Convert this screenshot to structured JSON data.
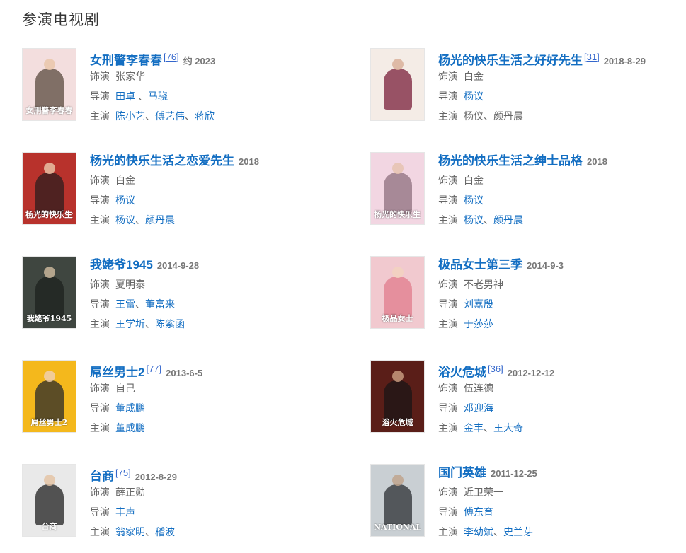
{
  "section_title": "参演电视剧",
  "items": [
    {
      "title": "女刑警李春春",
      "ref": "[76]",
      "year": "约 2023",
      "role": {
        "label": "饰演",
        "value": "张家华"
      },
      "director": {
        "label": "导演",
        "names": [
          "田卓",
          "马骁"
        ],
        "sep": " 、"
      },
      "cast": {
        "label": "主演",
        "names": [
          "陈小艺",
          "傅艺伟",
          "蒋欣"
        ],
        "sep": "、"
      },
      "poster": {
        "text": "女刑警李春春",
        "bg": "#f3dede",
        "fig": "#5a4a3e",
        "head": "#e9c7aa"
      }
    },
    {
      "title": "杨光的快乐生活之好好先生",
      "ref": "[31]",
      "year": "2018-8-29",
      "role": {
        "label": "饰演",
        "value": "白金"
      },
      "director": {
        "label": "导演",
        "names": [
          "杨议"
        ],
        "sep": "、"
      },
      "cast": {
        "label": "主演",
        "value": "杨仪、颜丹晨"
      },
      "poster": {
        "text": "",
        "bg": "#f4ece6",
        "fig": "#7a1f3a",
        "head": "#d9b29a"
      }
    },
    {
      "title": "杨光的快乐生活之恋爱先生",
      "ref": "",
      "year": "2018",
      "role": {
        "label": "饰演",
        "value": "白金"
      },
      "director": {
        "label": "导演",
        "names": [
          "杨议"
        ],
        "sep": "、"
      },
      "cast": {
        "label": "主演",
        "names": [
          "杨议",
          "颜丹晨"
        ],
        "sep": "、"
      },
      "poster": {
        "text": "杨光的快乐生活",
        "bg": "#b8322c",
        "fig": "#2c1e1e",
        "head": "#e8c1a4"
      }
    },
    {
      "title": "杨光的快乐生活之绅士品格",
      "ref": "",
      "year": "2018",
      "role": {
        "label": "饰演",
        "value": "白金"
      },
      "director": {
        "label": "导演",
        "names": [
          "杨议"
        ],
        "sep": "、"
      },
      "cast": {
        "label": "主演",
        "names": [
          "杨议",
          "颜丹晨"
        ],
        "sep": "、"
      },
      "poster": {
        "text": "杨光的快乐生活",
        "bg": "#f2d6e2",
        "fig": "#8e6f7e",
        "head": "#e6c3b0"
      }
    },
    {
      "title": "我姥爷1945",
      "ref": "",
      "year": "2014-9-28",
      "role": {
        "label": "饰演",
        "value": "夏明泰"
      },
      "director": {
        "label": "导演",
        "names": [
          "王雷",
          "董富来"
        ],
        "sep": "、"
      },
      "cast": {
        "label": "主演",
        "names": [
          "王学圻",
          "陈紫函"
        ],
        "sep": "、"
      },
      "poster": {
        "text": "我姥爷1945",
        "bg": "#3f4640",
        "fig": "#1d211e",
        "head": "#c8b59a"
      }
    },
    {
      "title": "极品女士第三季",
      "ref": "",
      "year": "2014-9-3",
      "role": {
        "label": "饰演",
        "value": "不老男神"
      },
      "director": {
        "label": "导演",
        "names": [
          "刘嘉殷"
        ],
        "sep": "、"
      },
      "cast": {
        "label": "主演",
        "names": [
          "于莎莎"
        ],
        "sep": "、"
      },
      "poster": {
        "text": "极品女士",
        "bg": "#f1c9cf",
        "fig": "#e07b8c",
        "head": "#f2d2c0"
      }
    },
    {
      "title": "屌丝男士2",
      "ref": "[77]",
      "year": "2013-6-5",
      "role": {
        "label": "饰演",
        "value": "自己"
      },
      "director": {
        "label": "导演",
        "names": [
          "董成鹏"
        ],
        "sep": "、"
      },
      "cast": {
        "label": "主演",
        "names": [
          "董成鹏"
        ],
        "sep": "、"
      },
      "poster": {
        "text": "屌丝男士2",
        "bg": "#f4b81c",
        "fig": "#2a2a2a",
        "head": "#f0cfae"
      }
    },
    {
      "title": "浴火危城",
      "ref": "[36]",
      "year": "2012-12-12",
      "role": {
        "label": "饰演",
        "value": "伍连德"
      },
      "director": {
        "label": "导演",
        "names": [
          "邓迎海"
        ],
        "sep": "、"
      },
      "cast": {
        "label": "主演",
        "names": [
          "金丰",
          "王大奇"
        ],
        "sep": "、"
      },
      "poster": {
        "text": "浴火危城",
        "bg": "#5a1e18",
        "fig": "#1b1515",
        "head": "#c79a7e"
      }
    },
    {
      "title": "台商",
      "ref": "[75]",
      "year": "2012-8-29",
      "role": {
        "label": "饰演",
        "value": "薛正勋"
      },
      "director": {
        "label": "导演",
        "names": [
          "丰声"
        ],
        "sep": "、"
      },
      "cast": {
        "label": "主演",
        "names": [
          "翁家明",
          "稽波"
        ],
        "sep": "、"
      },
      "poster": {
        "text": "台商",
        "bg": "#e9e9e9",
        "fig": "#1f1f1f",
        "head": "#e4c4a6"
      }
    },
    {
      "title": "国门英雄",
      "ref": "",
      "year": "2011-12-25",
      "role": {
        "label": "饰演",
        "value": "近卫荣一"
      },
      "director": {
        "label": "导演",
        "names": [
          "傅东育"
        ],
        "sep": "、"
      },
      "cast": {
        "label": "主演",
        "names": [
          "李幼斌",
          "史兰芽"
        ],
        "sep": "、"
      },
      "poster": {
        "text": "NATIONAL HEROES",
        "bg": "#c9cfd3",
        "fig": "#2b2f33",
        "head": "#bfa58d"
      }
    }
  ]
}
